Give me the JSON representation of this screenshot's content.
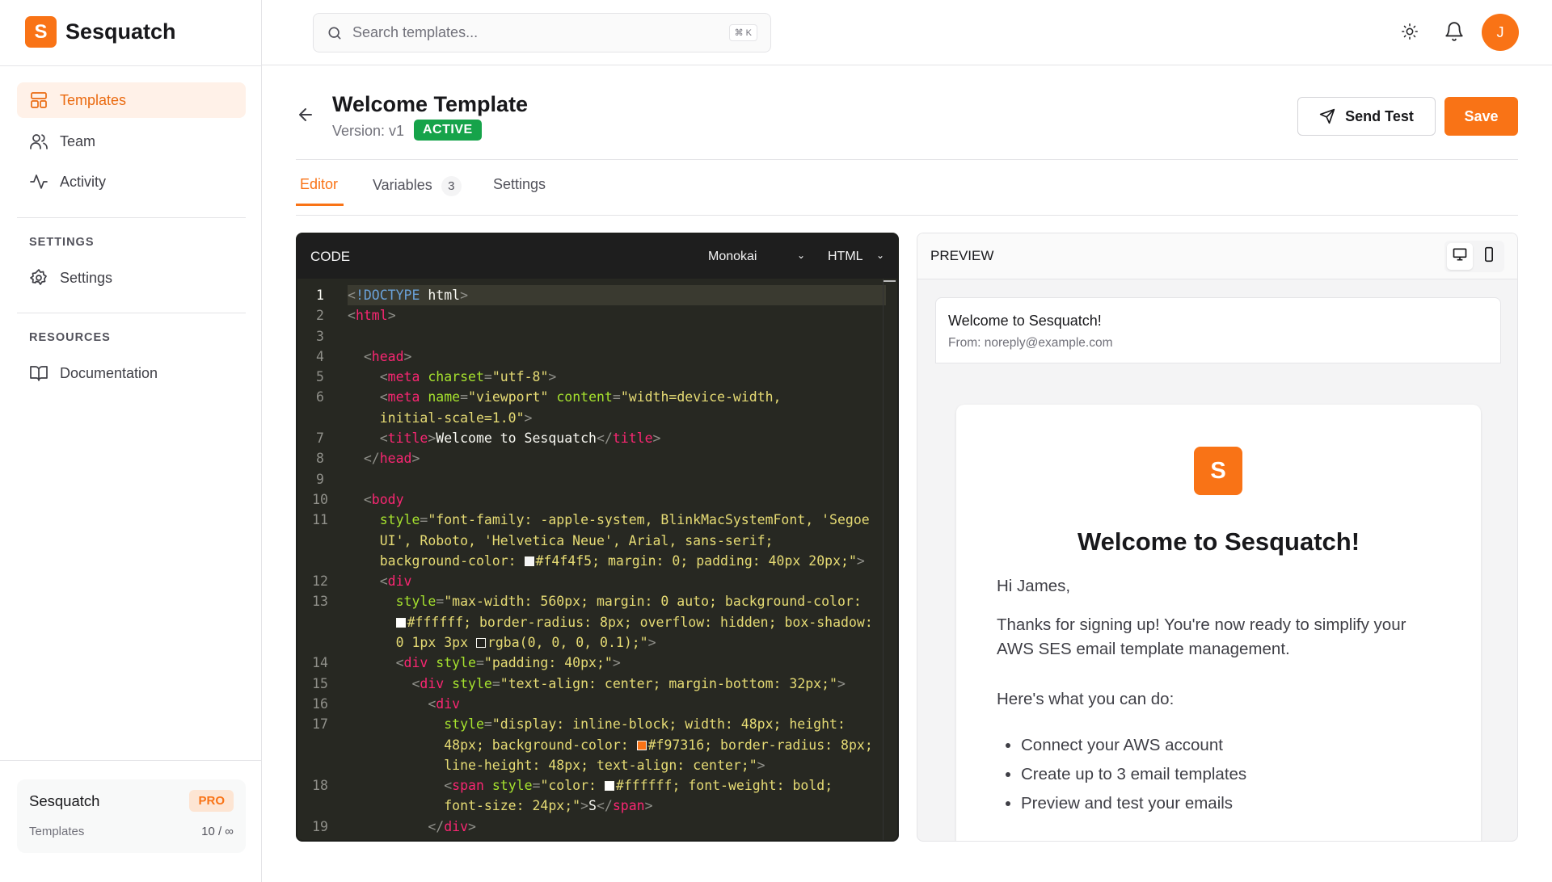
{
  "brand": {
    "logo_letter": "S",
    "name": "Sesquatch"
  },
  "sidebar": {
    "items": [
      {
        "label": "Templates"
      },
      {
        "label": "Team"
      },
      {
        "label": "Activity"
      }
    ],
    "settings_section": "SETTINGS",
    "settings_item": "Settings",
    "resources_section": "RESOURCES",
    "resources_item": "Documentation",
    "plan": {
      "name": "Sesquatch",
      "badge": "PRO",
      "usage_label": "Templates",
      "usage_value": "10 / ∞"
    }
  },
  "topbar": {
    "search_placeholder": "Search templates...",
    "shortcut": "⌘ K",
    "avatar_initial": "J"
  },
  "page": {
    "title": "Welcome Template",
    "version": "Version: v1",
    "status": "ACTIVE",
    "send_test": "Send Test",
    "save": "Save"
  },
  "tabs": [
    {
      "label": "Editor"
    },
    {
      "label": "Variables",
      "count": "3"
    },
    {
      "label": "Settings"
    }
  ],
  "colors": {
    "accent": "#f97316",
    "active": "#16a34a"
  },
  "code": {
    "title": "CODE",
    "theme": "Monokai",
    "language": "HTML",
    "rows": [
      {
        "n": "1",
        "i": 0,
        "k": [
          [
            "p",
            "<"
          ],
          [
            "d",
            "!DOCTYPE"
          ],
          [
            "x",
            " html"
          ],
          [
            "p",
            ">"
          ]
        ]
      },
      {
        "n": "2",
        "i": 0,
        "k": [
          [
            "p",
            "<"
          ],
          [
            "t",
            "html"
          ],
          [
            "p",
            ">"
          ]
        ]
      },
      {
        "n": "3",
        "i": 0,
        "k": []
      },
      {
        "n": "4",
        "i": 1,
        "k": [
          [
            "p",
            "<"
          ],
          [
            "t",
            "head"
          ],
          [
            "p",
            ">"
          ]
        ]
      },
      {
        "n": "5",
        "i": 2,
        "k": [
          [
            "p",
            "<"
          ],
          [
            "t",
            "meta"
          ],
          [
            "x",
            " "
          ],
          [
            "a",
            "charset"
          ],
          [
            "p",
            "="
          ],
          [
            "s",
            "\"utf-8\""
          ],
          [
            "p",
            ">"
          ]
        ]
      },
      {
        "n": "6",
        "i": 2,
        "k": [
          [
            "p",
            "<"
          ],
          [
            "t",
            "meta"
          ],
          [
            "x",
            " "
          ],
          [
            "a",
            "name"
          ],
          [
            "p",
            "="
          ],
          [
            "s",
            "\"viewport\""
          ],
          [
            "x",
            " "
          ],
          [
            "a",
            "content"
          ],
          [
            "p",
            "="
          ],
          [
            "s",
            "\"width=device-width,"
          ]
        ]
      },
      {
        "n": "",
        "i": 2,
        "k": [
          [
            "s",
            "initial-scale=1.0\""
          ],
          [
            "p",
            ">"
          ]
        ]
      },
      {
        "n": "7",
        "i": 2,
        "k": [
          [
            "p",
            "<"
          ],
          [
            "t",
            "title"
          ],
          [
            "p",
            ">"
          ],
          [
            "x",
            "Welcome to Sesquatch"
          ],
          [
            "p",
            "</"
          ],
          [
            "t",
            "title"
          ],
          [
            "p",
            ">"
          ]
        ]
      },
      {
        "n": "8",
        "i": 1,
        "k": [
          [
            "p",
            "</"
          ],
          [
            "t",
            "head"
          ],
          [
            "p",
            ">"
          ]
        ]
      },
      {
        "n": "9",
        "i": 0,
        "k": []
      },
      {
        "n": "10",
        "i": 1,
        "k": [
          [
            "p",
            "<"
          ],
          [
            "t",
            "body"
          ]
        ]
      },
      {
        "n": "11",
        "i": 2,
        "k": [
          [
            "a",
            "style"
          ],
          [
            "p",
            "="
          ],
          [
            "s",
            "\"font-family: -apple-system, BlinkMacSystemFont, 'Segoe"
          ]
        ]
      },
      {
        "n": "",
        "i": 2,
        "k": [
          [
            "s",
            "UI', Roboto, 'Helvetica Neue', Arial, sans-serif;"
          ]
        ]
      },
      {
        "n": "",
        "i": 2,
        "k": [
          [
            "s",
            "background-color: "
          ],
          [
            "w",
            "#f4f4f5"
          ],
          [
            "s",
            "#f4f4f5; margin: 0; padding: 40px 20px;\""
          ],
          [
            "p",
            ">"
          ]
        ]
      },
      {
        "n": "12",
        "i": 2,
        "k": [
          [
            "p",
            "<"
          ],
          [
            "t",
            "div"
          ]
        ]
      },
      {
        "n": "13",
        "i": 3,
        "k": [
          [
            "a",
            "style"
          ],
          [
            "p",
            "="
          ],
          [
            "s",
            "\"max-width: 560px; margin: 0 auto; background-color:"
          ]
        ]
      },
      {
        "n": "",
        "i": 3,
        "k": [
          [
            "w",
            "#ffffff"
          ],
          [
            "s",
            "#ffffff; border-radius: 8px; overflow: hidden; box-shadow:"
          ]
        ]
      },
      {
        "n": "",
        "i": 3,
        "k": [
          [
            "s",
            "0 1px 3px "
          ],
          [
            "w",
            "rgba(0,0,0,0.1)"
          ],
          [
            "s",
            "rgba(0, 0, 0, 0.1);\""
          ],
          [
            "p",
            ">"
          ]
        ]
      },
      {
        "n": "14",
        "i": 3,
        "k": [
          [
            "p",
            "<"
          ],
          [
            "t",
            "div"
          ],
          [
            "x",
            " "
          ],
          [
            "a",
            "style"
          ],
          [
            "p",
            "="
          ],
          [
            "s",
            "\"padding: 40px;\""
          ],
          [
            "p",
            ">"
          ]
        ]
      },
      {
        "n": "15",
        "i": 4,
        "k": [
          [
            "p",
            "<"
          ],
          [
            "t",
            "div"
          ],
          [
            "x",
            " "
          ],
          [
            "a",
            "style"
          ],
          [
            "p",
            "="
          ],
          [
            "s",
            "\"text-align: center; margin-bottom: 32px;\""
          ],
          [
            "p",
            ">"
          ]
        ]
      },
      {
        "n": "16",
        "i": 5,
        "k": [
          [
            "p",
            "<"
          ],
          [
            "t",
            "div"
          ]
        ]
      },
      {
        "n": "17",
        "i": 6,
        "k": [
          [
            "a",
            "style"
          ],
          [
            "p",
            "="
          ],
          [
            "s",
            "\"display: inline-block; width: 48px; height:"
          ]
        ]
      },
      {
        "n": "",
        "i": 6,
        "k": [
          [
            "s",
            "48px; background-color: "
          ],
          [
            "w",
            "#f97316"
          ],
          [
            "s",
            "#f97316; border-radius: 8px;"
          ]
        ]
      },
      {
        "n": "",
        "i": 6,
        "k": [
          [
            "s",
            "line-height: 48px; text-align: center;\""
          ],
          [
            "p",
            ">"
          ]
        ]
      },
      {
        "n": "18",
        "i": 6,
        "k": [
          [
            "p",
            "<"
          ],
          [
            "t",
            "span"
          ],
          [
            "x",
            " "
          ],
          [
            "a",
            "style"
          ],
          [
            "p",
            "="
          ],
          [
            "s",
            "\"color: "
          ],
          [
            "w",
            "#ffffff"
          ],
          [
            "s",
            "#ffffff; font-weight: bold;"
          ]
        ]
      },
      {
        "n": "",
        "i": 6,
        "k": [
          [
            "s",
            "font-size: 24px;\""
          ],
          [
            "p",
            ">"
          ],
          [
            "x",
            "S"
          ],
          [
            "p",
            "</"
          ],
          [
            "t",
            "span"
          ],
          [
            "p",
            ">"
          ]
        ]
      },
      {
        "n": "19",
        "i": 5,
        "k": [
          [
            "p",
            "</"
          ],
          [
            "t",
            "div"
          ],
          [
            "p",
            ">"
          ]
        ]
      }
    ]
  },
  "preview": {
    "title": "PREVIEW",
    "subject": "Welcome to Sesquatch!",
    "from": "From: noreply@example.com",
    "logo_letter": "S",
    "heading": "Welcome to Sesquatch!",
    "greeting": "Hi James,",
    "intro": "Thanks for signing up! You're now ready to simplify your AWS SES email template management.",
    "list_intro": "Here's what you can do:",
    "bullets": [
      "Connect your AWS account",
      "Create up to 3 email templates",
      "Preview and test your emails"
    ]
  }
}
